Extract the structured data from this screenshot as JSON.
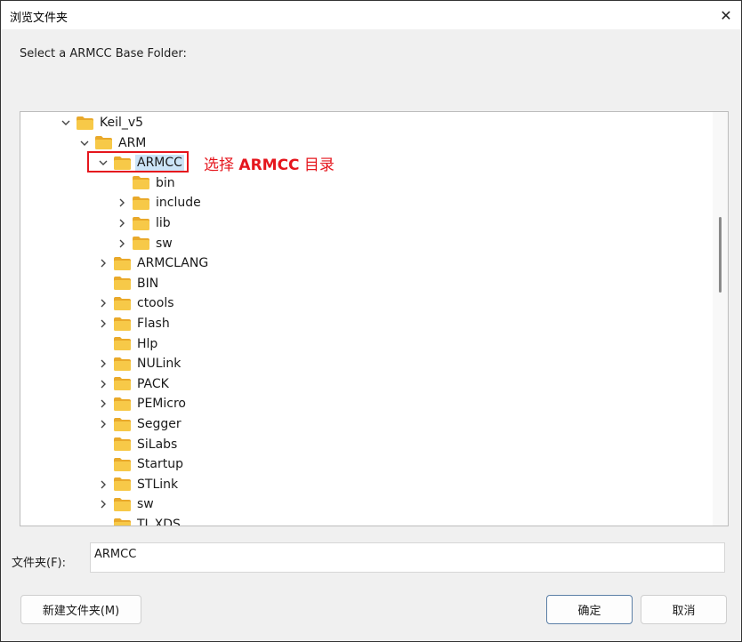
{
  "window": {
    "title": "浏览文件夹",
    "close_glyph": "✕"
  },
  "prompt": "Select a ARMCC Base Folder:",
  "tree": [
    {
      "label": "Keil_v5",
      "expander": "expanded",
      "selected": false
    },
    {
      "label": "ARM",
      "expander": "expanded",
      "selected": false
    },
    {
      "label": "ARMCC",
      "expander": "expanded",
      "selected": true
    },
    {
      "label": "bin",
      "expander": "none",
      "selected": false
    },
    {
      "label": "include",
      "expander": "collapsed",
      "selected": false
    },
    {
      "label": "lib",
      "expander": "collapsed",
      "selected": false
    },
    {
      "label": "sw",
      "expander": "collapsed",
      "selected": false
    },
    {
      "label": "ARMCLANG",
      "expander": "collapsed",
      "selected": false
    },
    {
      "label": "BIN",
      "expander": "none",
      "selected": false
    },
    {
      "label": "ctools",
      "expander": "collapsed",
      "selected": false
    },
    {
      "label": "Flash",
      "expander": "collapsed",
      "selected": false
    },
    {
      "label": "Hlp",
      "expander": "none",
      "selected": false
    },
    {
      "label": "NULink",
      "expander": "collapsed",
      "selected": false
    },
    {
      "label": "PACK",
      "expander": "collapsed",
      "selected": false
    },
    {
      "label": "PEMicro",
      "expander": "collapsed",
      "selected": false
    },
    {
      "label": "Segger",
      "expander": "collapsed",
      "selected": false
    },
    {
      "label": "SiLabs",
      "expander": "none",
      "selected": false
    },
    {
      "label": "Startup",
      "expander": "none",
      "selected": false
    },
    {
      "label": "STLink",
      "expander": "collapsed",
      "selected": false
    },
    {
      "label": "sw",
      "expander": "collapsed",
      "selected": false
    },
    {
      "label": "TI_XDS",
      "expander": "none",
      "selected": false
    }
  ],
  "annotation": {
    "prefix": "选择 ",
    "bold": "ARMCC",
    "suffix": " 目录",
    "color": "#e5161d"
  },
  "folder_field": {
    "label": "文件夹(F):",
    "value": "ARMCC"
  },
  "buttons": {
    "new_folder": "新建文件夹(M)",
    "ok": "确定",
    "cancel": "取消"
  },
  "colors": {
    "folder": "#f7c948",
    "folder_tab": "#e9a92a",
    "selection": "#cce4f7"
  },
  "icons": {
    "expanded": "chevron-down-icon",
    "collapsed": "chevron-right-icon",
    "folder": "folder-icon",
    "close": "close-icon"
  }
}
